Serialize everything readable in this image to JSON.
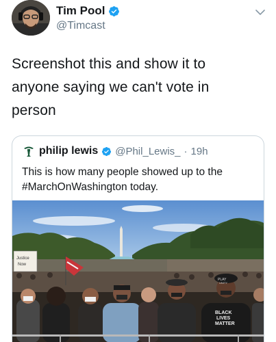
{
  "tweet": {
    "display_name": "Tim Pool",
    "handle": "@Timcast",
    "text_lines": [
      "Screenshot this and show it to",
      "anyone saying we can't vote in",
      "person"
    ]
  },
  "quote": {
    "display_name": "philip lewis",
    "handle": "@Phil_Lewis_",
    "separator": "·",
    "time": "19h",
    "text_line1": "This is how many people showed up to the",
    "hashtag": "#MarchOnWashington",
    "text_suffix": " today."
  },
  "media": {
    "sign_left": "Justice Now",
    "shirt_text": "BLACK LIVES MATTER",
    "hat_text": "PLAY UNITY"
  },
  "colors": {
    "verified_blue": "#1da1f2",
    "secondary_text": "#657786",
    "border": "#ccd6dd"
  },
  "icons": [
    "verified-badge-icon",
    "chevron-down-icon"
  ]
}
